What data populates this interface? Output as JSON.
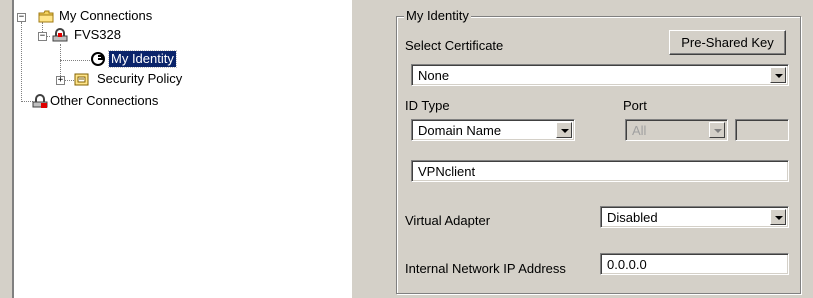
{
  "tree": {
    "my_connections": "My Connections",
    "fvs328": "FVS328",
    "my_identity": "My Identity",
    "security_policy": "Security Policy",
    "other_connections": "Other Connections"
  },
  "identity": {
    "group_title": "My Identity",
    "select_certificate_label": "Select Certificate",
    "pre_shared_key_button": "Pre-Shared Key",
    "certificate_value": "None",
    "id_type_label": "ID Type",
    "id_type_value": "Domain Name",
    "port_label": "Port",
    "port_value": "All",
    "port_text_value": "",
    "id_value": "VPNclient",
    "virtual_adapter_label": "Virtual Adapter",
    "virtual_adapter_value": "Disabled",
    "internal_ip_label": "Internal Network IP Address",
    "internal_ip_value": "0.0.0.0"
  },
  "colors": {
    "selection": "#0a246a",
    "panel": "#d4d0c8"
  },
  "icons": {
    "my_connections": "folder-icon",
    "fvs328": "connection-lock-icon",
    "my_identity": "identity-icon",
    "security_policy": "security-policy-icon",
    "other_connections": "other-connections-icon"
  }
}
